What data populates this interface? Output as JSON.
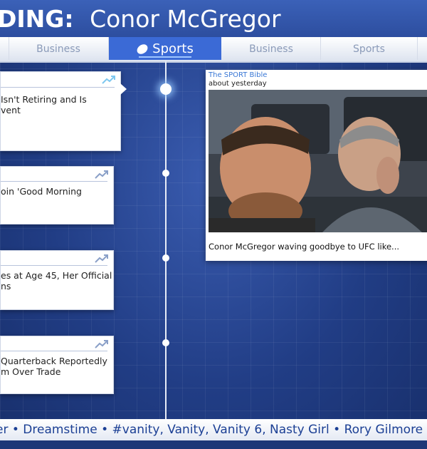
{
  "header": {
    "prefix": "DING:",
    "topic": "Conor McGregor"
  },
  "tabs": [
    {
      "label": "Business",
      "active": false
    },
    {
      "label": "Sports",
      "active": true
    },
    {
      "label": "Business",
      "active": false
    },
    {
      "label": "Sports",
      "active": false
    }
  ],
  "cards": [
    {
      "text": "Isn't Retiring and Is\nvent"
    },
    {
      "text": "oin 'Good Morning"
    },
    {
      "text": "es at Age 45, Her Official\nns"
    },
    {
      "text": "Quarterback Reportedly\nm Over Trade"
    }
  ],
  "story": {
    "source": "The SPORT Bible",
    "time": "about yesterday",
    "caption": "Conor McGregor waving goodbye to UFC like..."
  },
  "ticker": {
    "text": "er • Dreamstime • #vanity, Vanity, Vanity 6, Nasty Girl • Rory Gilmore •"
  },
  "colors": {
    "accent": "#3b6ad6",
    "header": "#2d4e9f",
    "trend_icon": "#8aa0c8"
  }
}
